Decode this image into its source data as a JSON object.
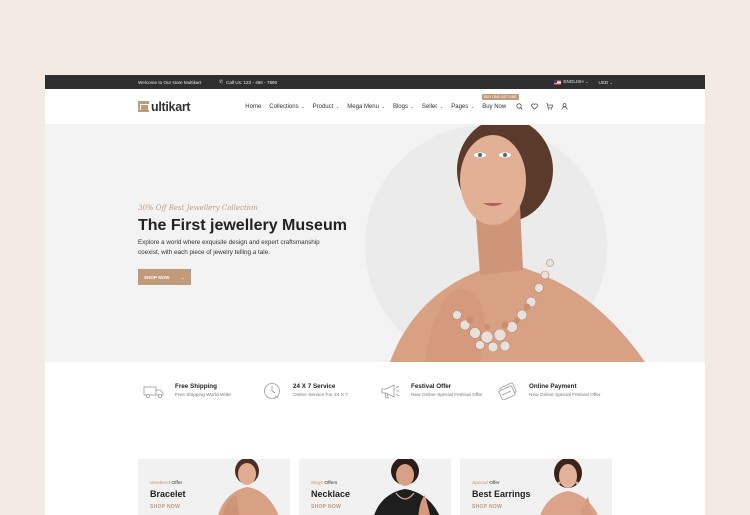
{
  "topbar": {
    "welcome": "Welcome to Our store Multikart",
    "phone": "Call Us: 123 - 456 - 7890",
    "language": "ENGLISH",
    "currency": "USD"
  },
  "header": {
    "logo_text": "ultikart",
    "nav": [
      "Home",
      "Collections",
      "Product",
      "Mega Menu",
      "Blogs",
      "Seller",
      "Pages"
    ],
    "buy_now": "Buy Now",
    "buy_badge": "BUY ONE GET ONE"
  },
  "hero": {
    "subtitle": "30% Off Best Jewellery Collection",
    "title": "The First jewellery Museum",
    "description": "Explore a world where exquisite design and expert craftsmanship coexist, with each piece of jewelry telling a tale.",
    "cta": "SHOP NOW"
  },
  "services": [
    {
      "icon": "truck-icon",
      "title": "Free Shipping",
      "subtitle": "Free Shipping World Wide"
    },
    {
      "icon": "clock-24-icon",
      "title": "24 X 7 Service",
      "subtitle": "Online Service For 24 X 7"
    },
    {
      "icon": "megaphone-icon",
      "title": "Festival Offer",
      "subtitle": "New Online Special Festival Offer"
    },
    {
      "icon": "card-icon",
      "title": "Online Payment",
      "subtitle": "New Online Special Festival Offer"
    }
  ],
  "banners": [
    {
      "tag": "Weekend",
      "offer": "Offer",
      "name": "Bracelet",
      "cta": "SHOP NOW"
    },
    {
      "tag": "Mega",
      "offer": "Offers",
      "name": "Necklace",
      "cta": "SHOP NOW"
    },
    {
      "tag": "Special",
      "offer": "Offer",
      "name": "Best Earrings",
      "cta": "SHOP NOW"
    }
  ],
  "colors": {
    "accent": "#c19a7b",
    "topbar": "#2f2f2f",
    "page_bg": "#f3ebe3"
  }
}
